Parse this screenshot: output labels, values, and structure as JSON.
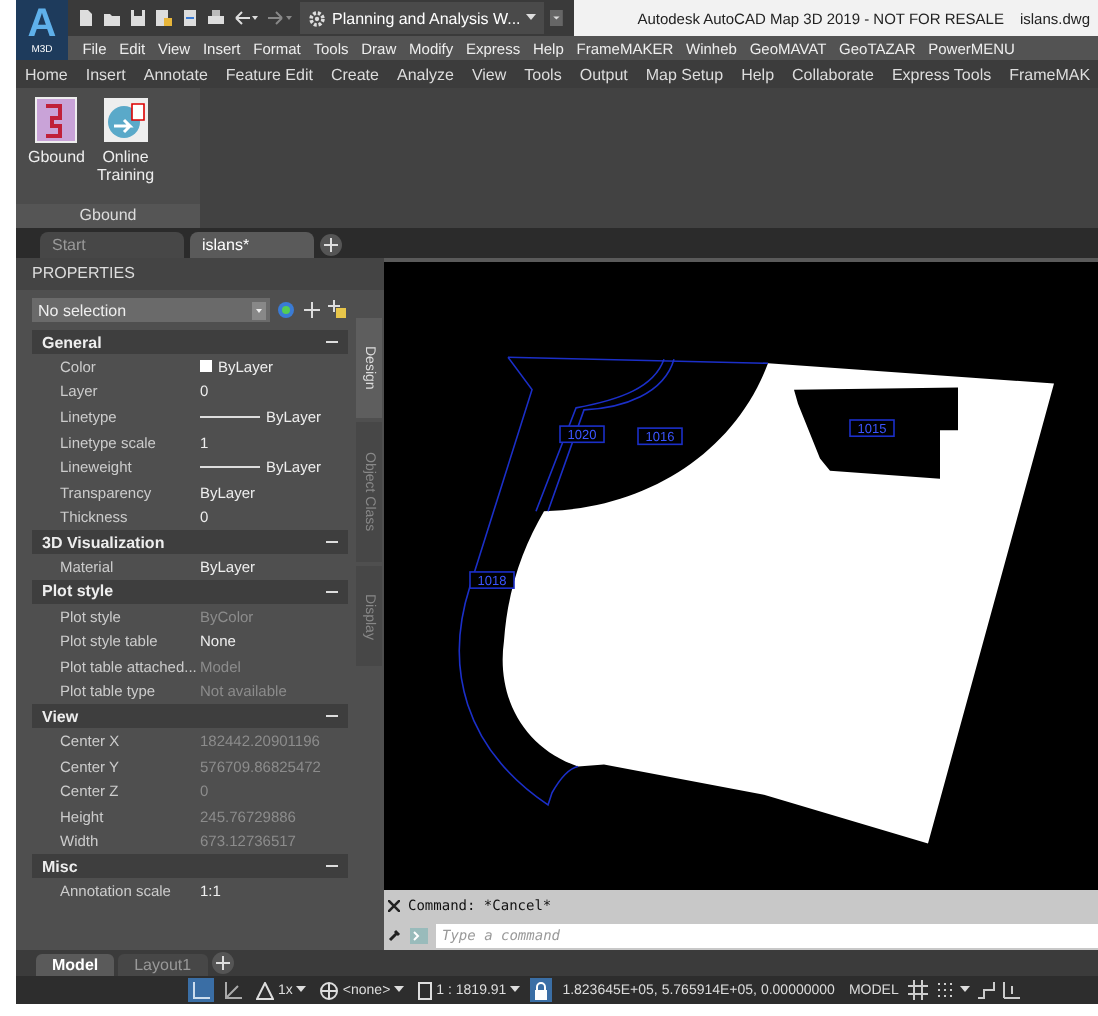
{
  "app_logo": {
    "letter": "A",
    "caption": "M3D"
  },
  "workspace": {
    "label": "Planning and Analysis W..."
  },
  "window": {
    "title": "Autodesk AutoCAD Map 3D 2019 - NOT FOR RESALE",
    "file": "islans.dwg"
  },
  "menu_bar": [
    "File",
    "Edit",
    "View",
    "Insert",
    "Format",
    "Tools",
    "Draw",
    "Modify",
    "Express",
    "Help",
    "FrameMAKER",
    "Winheb",
    "GeoMAVAT",
    "GeoTAZAR",
    "PowerMENU"
  ],
  "ribbon_tabs": [
    {
      "label": "Home",
      "selected": false
    },
    {
      "label": "Insert",
      "selected": false
    },
    {
      "label": "Annotate",
      "selected": false
    },
    {
      "label": "Feature Edit",
      "selected": false
    },
    {
      "label": "Create",
      "selected": false
    },
    {
      "label": "Analyze",
      "selected": false
    },
    {
      "label": "View",
      "selected": false
    },
    {
      "label": "Tools",
      "selected": false
    },
    {
      "label": "Output",
      "selected": false
    },
    {
      "label": "Map Setup",
      "selected": false
    },
    {
      "label": "Help",
      "selected": false
    },
    {
      "label": "Collaborate",
      "selected": false
    },
    {
      "label": "Express Tools",
      "selected": false
    },
    {
      "label": "FrameMAK",
      "selected": false
    }
  ],
  "ribbon_panel": {
    "title": "Gbound",
    "buttons": [
      {
        "label": "Gbound",
        "kind": "gbound"
      },
      {
        "label": "Online\nTraining",
        "kind": "training"
      }
    ]
  },
  "doc_tabs": [
    {
      "label": "Start",
      "selected": false
    },
    {
      "label": "islans*",
      "selected": true
    }
  ],
  "properties": {
    "title": "PROPERTIES",
    "selection": "No selection",
    "side_tabs": [
      {
        "label": "Design",
        "selected": true
      },
      {
        "label": "Object Class",
        "selected": false
      },
      {
        "label": "Display",
        "selected": false
      }
    ],
    "sections": [
      {
        "title": "General",
        "expanded": true,
        "rows": [
          {
            "label": "Color",
            "value": "ByLayer",
            "kind": "color",
            "dimmed": false
          },
          {
            "label": "Layer",
            "value": "0",
            "kind": "text",
            "dimmed": false
          },
          {
            "label": "Linetype",
            "value": "ByLayer",
            "kind": "line",
            "dimmed": false
          },
          {
            "label": "Linetype scale",
            "value": "1",
            "kind": "text",
            "dimmed": false
          },
          {
            "label": "Lineweight",
            "value": "ByLayer",
            "kind": "line",
            "dimmed": false
          },
          {
            "label": "Transparency",
            "value": "ByLayer",
            "kind": "text",
            "dimmed": false
          },
          {
            "label": "Thickness",
            "value": "0",
            "kind": "text",
            "dimmed": false
          }
        ]
      },
      {
        "title": "3D Visualization",
        "expanded": true,
        "rows": [
          {
            "label": "Material",
            "value": "ByLayer",
            "kind": "text",
            "dimmed": false
          }
        ]
      },
      {
        "title": "Plot style",
        "expanded": true,
        "rows": [
          {
            "label": "Plot style",
            "value": "ByColor",
            "kind": "text",
            "dimmed": true
          },
          {
            "label": "Plot style table",
            "value": "None",
            "kind": "text",
            "dimmed": false
          },
          {
            "label": "Plot table attached...",
            "value": "Model",
            "kind": "text",
            "dimmed": true
          },
          {
            "label": "Plot table type",
            "value": "Not available",
            "kind": "text",
            "dimmed": true
          }
        ]
      },
      {
        "title": "View",
        "expanded": true,
        "rows": [
          {
            "label": "Center X",
            "value": "182442.20901196",
            "kind": "text",
            "dimmed": true
          },
          {
            "label": "Center Y",
            "value": "576709.86825472",
            "kind": "text",
            "dimmed": true
          },
          {
            "label": "Center Z",
            "value": "0",
            "kind": "text",
            "dimmed": true
          },
          {
            "label": "Height",
            "value": "245.76729886",
            "kind": "text",
            "dimmed": true
          },
          {
            "label": "Width",
            "value": "673.12736517",
            "kind": "text",
            "dimmed": true
          }
        ]
      },
      {
        "title": "Misc",
        "expanded": true,
        "rows": [
          {
            "label": "Annotation scale",
            "value": "1:1",
            "kind": "text",
            "dimmed": false
          }
        ]
      }
    ]
  },
  "canvas": {
    "labels": [
      "1020",
      "1016",
      "1015",
      "1018"
    ]
  },
  "command": {
    "history": "Command: *Cancel*",
    "placeholder": "Type a command"
  },
  "layout_tabs": [
    {
      "label": "Model",
      "selected": true
    },
    {
      "label": "Layout1",
      "selected": false
    }
  ],
  "status_bar": {
    "scale_factor": "1x",
    "coordinate_system": "<none>",
    "scale": "1 : 1819.91",
    "coordinates": "1.823645E+05, 5.765914E+05, 0.00000000",
    "space": "MODEL"
  }
}
